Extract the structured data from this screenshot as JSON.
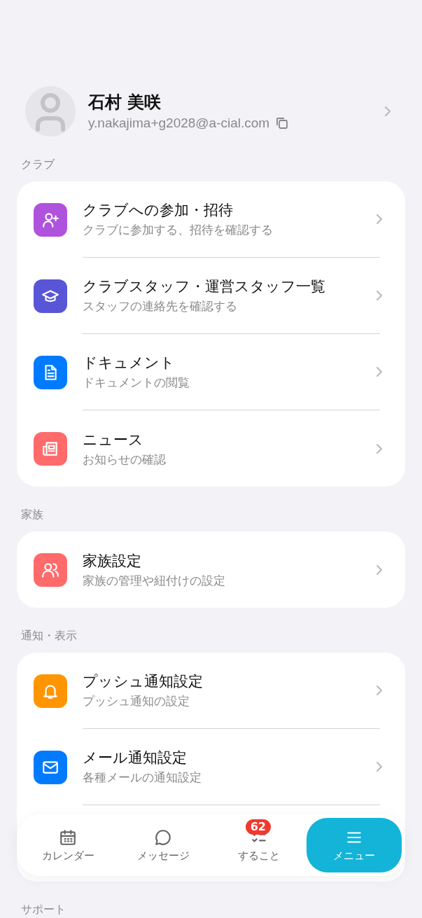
{
  "profile": {
    "name": "石村 美咲",
    "email": "y.nakajima+g2028@a-cial.com"
  },
  "sections": [
    {
      "title": "クラブ",
      "items": [
        {
          "title": "クラブへの参加・招待",
          "subtitle": "クラブに参加する、招待を確認する",
          "color": "#af52de"
        },
        {
          "title": "クラブスタッフ・運営スタッフ一覧",
          "subtitle": "スタッフの連絡先を確認する",
          "color": "#5856d6"
        },
        {
          "title": "ドキュメント",
          "subtitle": "ドキュメントの閲覧",
          "color": "#007aff"
        },
        {
          "title": "ニュース",
          "subtitle": "お知らせの確認",
          "color": "#ff6b6b"
        }
      ]
    },
    {
      "title": "家族",
      "items": [
        {
          "title": "家族設定",
          "subtitle": "家族の管理や紐付けの設定",
          "color": "#ff6b6b"
        }
      ]
    },
    {
      "title": "通知・表示",
      "items": [
        {
          "title": "プッシュ通知設定",
          "subtitle": "プッシュ通知の設定",
          "color": "#ff9500"
        },
        {
          "title": "メール通知設定",
          "subtitle": "各種メールの通知設定",
          "color": "#007aff"
        }
      ]
    },
    {
      "title": "サポート"
    }
  ],
  "bottom_nav": [
    {
      "label": "カレンダー",
      "selected": false
    },
    {
      "label": "メッセージ",
      "selected": false
    },
    {
      "label": "すること",
      "selected": false,
      "badge": "62"
    },
    {
      "label": "メニュー",
      "selected": true
    }
  ]
}
